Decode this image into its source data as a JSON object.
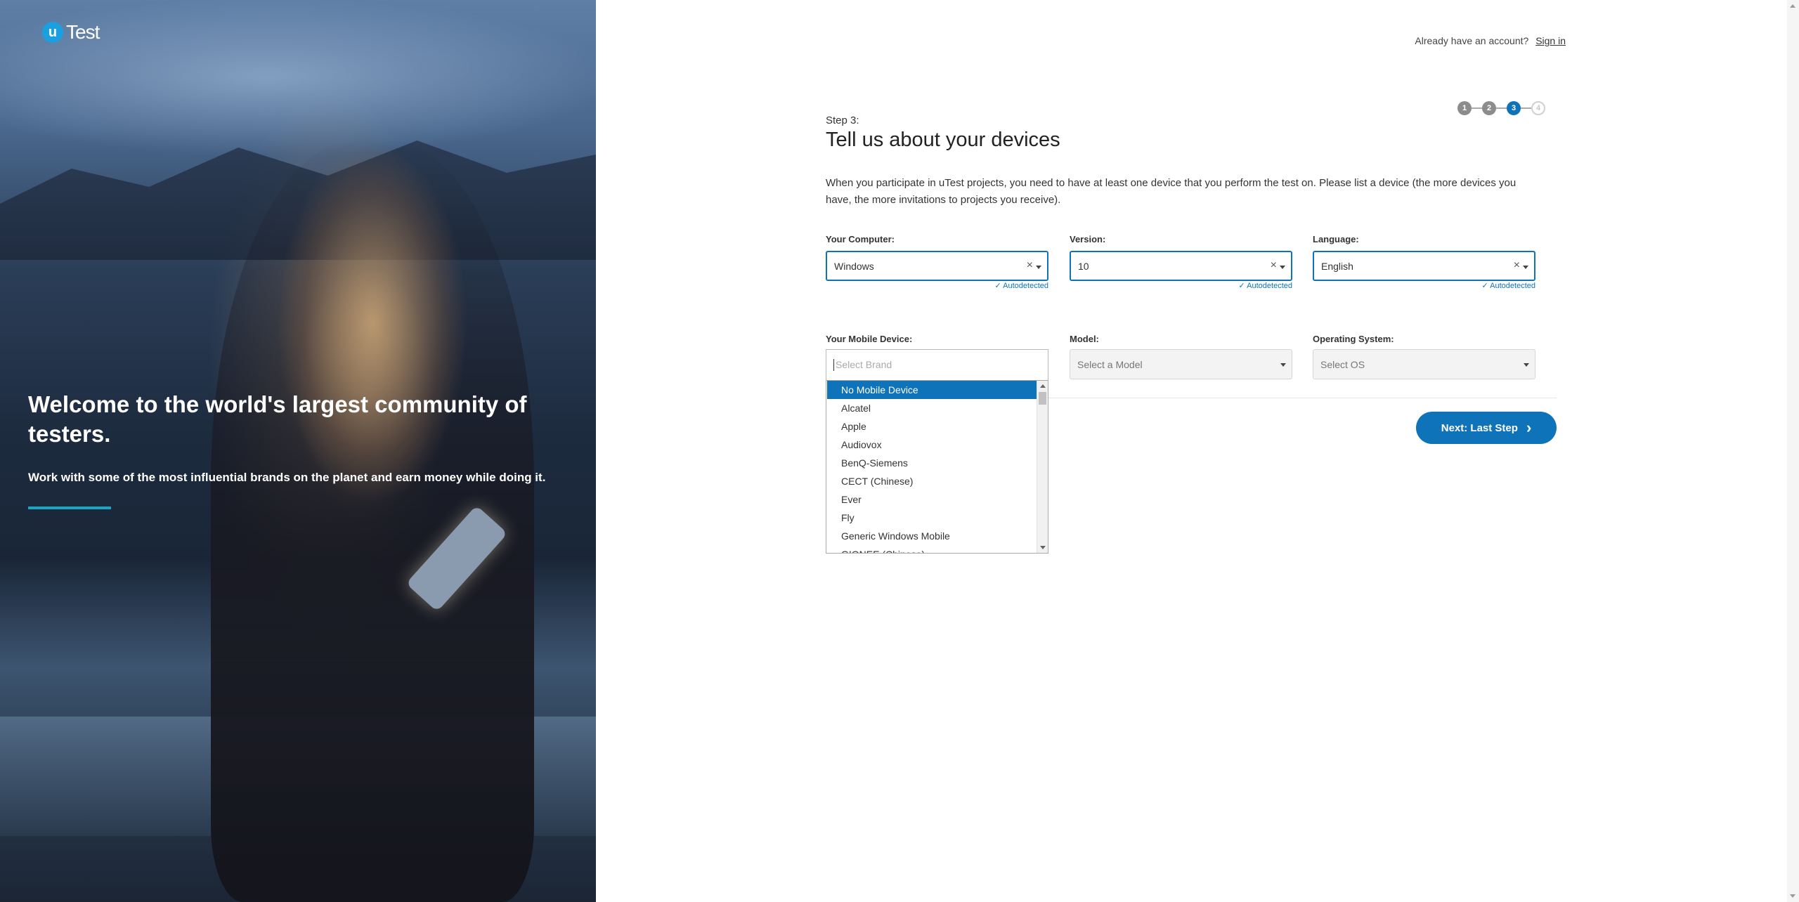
{
  "brand": {
    "logo_letter": "u",
    "logo_text": "Test"
  },
  "hero": {
    "title": "Welcome to the world's largest community of testers.",
    "subtitle": "Work with some of the most influential brands on the planet and earn money while doing it."
  },
  "header": {
    "prompt": "Already have an account?",
    "signin": "Sign in"
  },
  "steps": [
    {
      "label": "1",
      "state": "done"
    },
    {
      "label": "2",
      "state": "done"
    },
    {
      "label": "3",
      "state": "active"
    },
    {
      "label": "4",
      "state": "todo"
    }
  ],
  "form": {
    "step_label": "Step 3:",
    "title": "Tell us about your devices",
    "intro": "When you participate in uTest projects, you need to have at least one device that you perform the test on. Please list a device (the more devices you have, the more invitations to projects you receive).",
    "computer": {
      "label": "Your Computer:",
      "value": "Windows",
      "note": "✓ Autodetected"
    },
    "version": {
      "label": "Version:",
      "value": "10",
      "note": "✓ Autodetected"
    },
    "language": {
      "label": "Language:",
      "value": "English",
      "note": "✓ Autodetected"
    },
    "mobile": {
      "label": "Your Mobile Device:",
      "placeholder": "Select Brand",
      "options": [
        "No Mobile Device",
        "Alcatel",
        "Apple",
        "Audiovox",
        "BenQ-Siemens",
        "CECT (Chinese)",
        "Ever",
        "Fly",
        "Generic Windows Mobile",
        "GIONEE (Chinese)"
      ]
    },
    "model": {
      "label": "Model:",
      "placeholder": "Select a Model"
    },
    "os": {
      "label": "Operating System:",
      "placeholder": "Select OS"
    },
    "next_button": "Next: Last Step",
    "clear_glyph": "×",
    "next_glyph": "›"
  },
  "colors": {
    "accent": "#0f73b9",
    "hero_bar": "#18a6c7",
    "logo": "#1aa0e0"
  }
}
